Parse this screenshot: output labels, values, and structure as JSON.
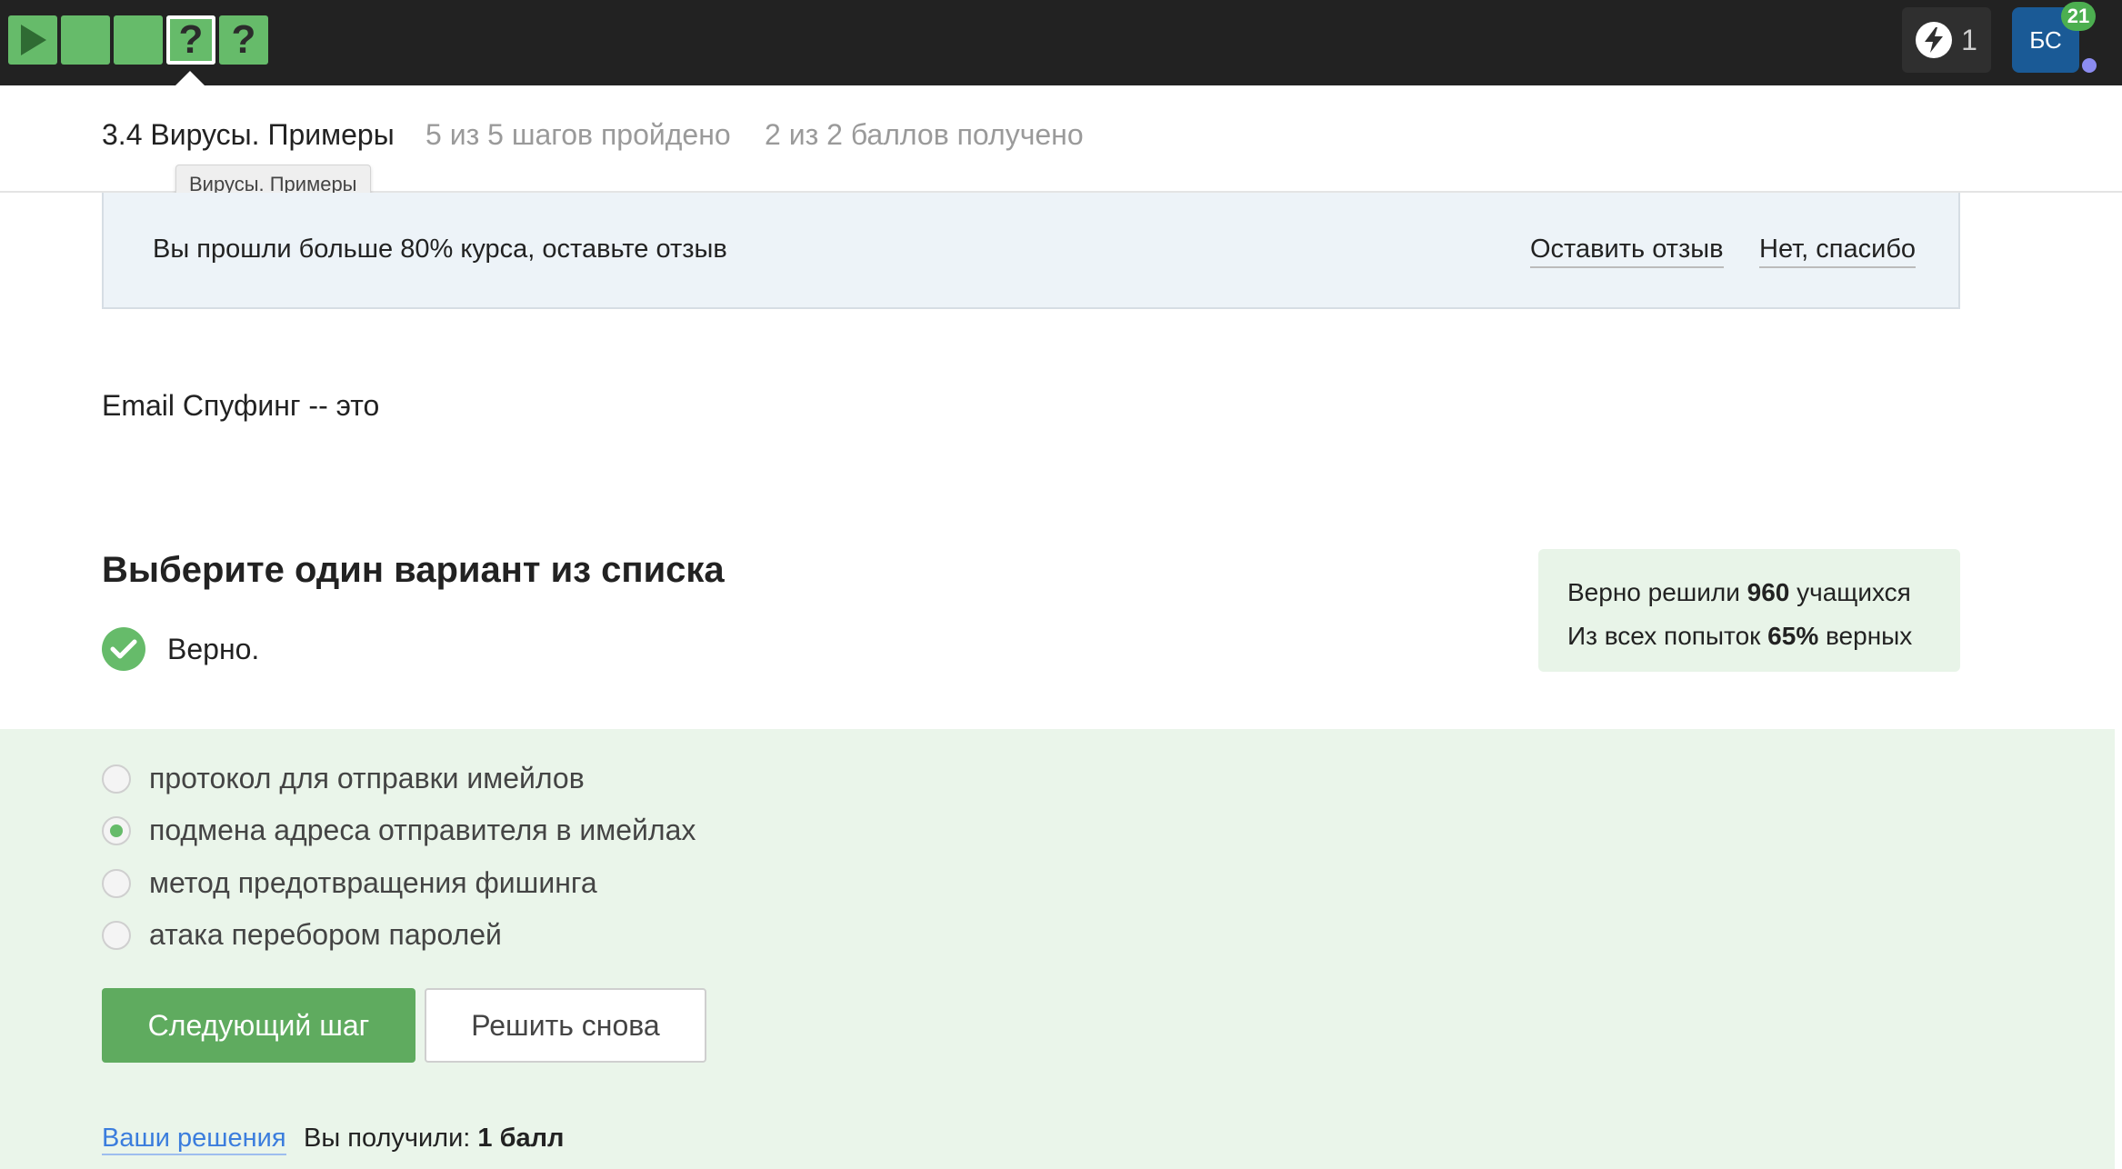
{
  "topbar": {
    "steps": [
      {
        "icon": "play-icon",
        "state": "done"
      },
      {
        "icon": "",
        "state": "done"
      },
      {
        "icon": "",
        "state": "done"
      },
      {
        "icon": "question-icon",
        "label": "?",
        "state": "active"
      },
      {
        "icon": "question-icon",
        "label": "?",
        "state": "done"
      }
    ],
    "energy_count": "1",
    "avatar_initials": "БС",
    "notifications_count": "21"
  },
  "lesson": {
    "title": "3.4 Вирусы. Примеры",
    "steps_progress": "5 из 5 шагов пройдено",
    "points_progress": "2 из 2 баллов  получено",
    "tooltip": "Вирусы. Примеры"
  },
  "banner": {
    "text": "Вы прошли больше 80% курса, оставьте отзыв",
    "leave_review": "Оставить отзыв",
    "no_thanks": "Нет, спасибо"
  },
  "question": {
    "text": "Email Спуфинг -- это",
    "choose_title": "Выберите один вариант из списка",
    "result": "Верно."
  },
  "stats": {
    "line1_prefix": "Верно решили ",
    "line1_value": "960",
    "line1_suffix": " учащихся",
    "line2_prefix": "Из всех попыток ",
    "line2_value": "65%",
    "line2_suffix": " верных"
  },
  "options": [
    {
      "label": "протокол для отправки имейлов",
      "selected": false
    },
    {
      "label": "подмена адреса отправителя в имейлах",
      "selected": true
    },
    {
      "label": "метод предотвращения фишинга",
      "selected": false
    },
    {
      "label": "атака перебором паролей",
      "selected": false
    }
  ],
  "buttons": {
    "next_step": "Следующий шаг",
    "solve_again": "Решить снова"
  },
  "footer": {
    "solutions_link": "Ваши решения",
    "score_prefix": "Вы получили: ",
    "score_value": "1 балл"
  },
  "colors": {
    "topbar": "#222222",
    "step_green": "#66bb6a",
    "answer_panel": "#eaf5ea",
    "button_green": "#5fab5f",
    "link_blue": "#3b7ddd"
  }
}
